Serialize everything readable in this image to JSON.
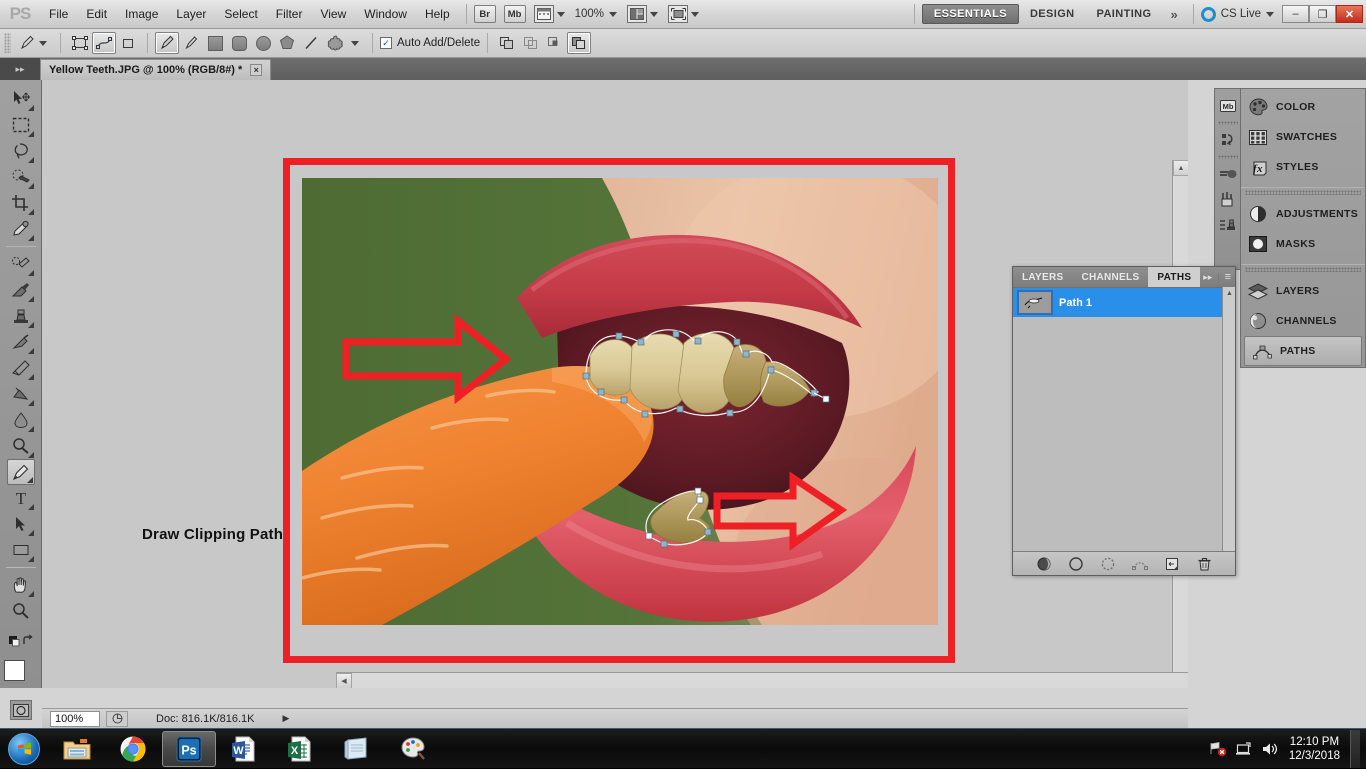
{
  "app": {
    "logo": "PS",
    "menus": [
      "File",
      "Edit",
      "Image",
      "Layer",
      "Select",
      "Filter",
      "View",
      "Window",
      "Help"
    ],
    "bridge_label": "Br",
    "minibridge_label": "Mb",
    "zoom_level": "100%",
    "workspaces": [
      {
        "label": "ESSENTIALS",
        "active": true
      },
      {
        "label": "DESIGN",
        "active": false
      },
      {
        "label": "PAINTING",
        "active": false
      }
    ],
    "more_workspaces": "»",
    "cslive_label": "CS Live",
    "window_controls": {
      "minimize": "–",
      "restore": "❐",
      "close": "✕"
    }
  },
  "options_bar": {
    "auto_add_delete_label": "Auto Add/Delete",
    "auto_add_delete_checked": true,
    "check_glyph": "✓",
    "tools": [
      "pen-tool",
      "freeform-pen-tool"
    ],
    "shape_tools": [
      "rectangle",
      "rounded-rectangle",
      "ellipse",
      "polygon",
      "line",
      "custom-shape"
    ],
    "mode_buttons": [
      "shape-layers",
      "paths",
      "fill-pixels"
    ],
    "path_ops": [
      "add-to-path-area",
      "subtract-from-path-area",
      "intersect-path-areas",
      "exclude-overlapping-path-areas"
    ]
  },
  "document": {
    "tab_title": "Yellow Teeth.JPG @ 100% (RGB/8#) *",
    "close_glyph": "×"
  },
  "toolbar": {
    "tools": [
      {
        "name": "move-tool",
        "selected": false
      },
      {
        "name": "rectangular-marquee-tool",
        "selected": false
      },
      {
        "name": "lasso-tool",
        "selected": false
      },
      {
        "name": "quick-selection-tool",
        "selected": false
      },
      {
        "name": "crop-tool",
        "selected": false
      },
      {
        "name": "eyedropper-tool",
        "selected": false
      },
      {
        "name": "spot-healing-brush-tool",
        "selected": false
      },
      {
        "name": "brush-tool",
        "selected": false
      },
      {
        "name": "clone-stamp-tool",
        "selected": false
      },
      {
        "name": "history-brush-tool",
        "selected": false
      },
      {
        "name": "eraser-tool",
        "selected": false
      },
      {
        "name": "gradient-tool",
        "selected": false
      },
      {
        "name": "blur-tool",
        "selected": false
      },
      {
        "name": "dodge-tool",
        "selected": false
      },
      {
        "name": "pen-tool",
        "selected": true
      },
      {
        "name": "horizontal-type-tool",
        "selected": false
      },
      {
        "name": "path-selection-tool",
        "selected": false
      },
      {
        "name": "rectangle-tool",
        "selected": false
      },
      {
        "name": "hand-tool",
        "selected": false
      },
      {
        "name": "zoom-tool",
        "selected": false
      }
    ],
    "foreground_color": "#ffffff",
    "background_color": "#ffffff",
    "quick_mask_name": "edit-in-quick-mask-mode"
  },
  "status_bar": {
    "zoom_value": "100%",
    "doc_info": "Doc: 816.1K/816.1K",
    "arrow_glyph": "▶"
  },
  "annotation": {
    "label": "Draw Clipping Path",
    "frame_color": "#ee2026",
    "arrows": [
      {
        "name": "arrow-pointing-to-upper-teeth",
        "direction": "right"
      },
      {
        "name": "arrow-pointing-to-lower-teeth",
        "direction": "left"
      }
    ]
  },
  "paths_panel": {
    "tabs": [
      {
        "label": "LAYERS",
        "active": false
      },
      {
        "label": "CHANNELS",
        "active": false
      },
      {
        "label": "PATHS",
        "active": true
      }
    ],
    "collapse_glyph": "▸▸",
    "menu_glyph": "≡",
    "paths": [
      {
        "name": "Path 1",
        "selected": true
      }
    ],
    "footer_buttons": [
      "fill-path-with-foreground-color",
      "stroke-path-with-brush",
      "load-path-as-selection",
      "make-work-path-from-selection",
      "create-new-path",
      "delete-current-path"
    ]
  },
  "dock": {
    "collapsed_icons": [
      "mini-bridge-icon",
      "history-icon",
      "brush-icon",
      "tool-presets-icon",
      "clone-source-icon"
    ],
    "groups": [
      {
        "items": [
          {
            "label": "COLOR",
            "icon": "color-palette-icon",
            "active": false
          },
          {
            "label": "SWATCHES",
            "icon": "swatches-grid-icon",
            "active": false
          },
          {
            "label": "STYLES",
            "icon": "styles-fx-icon",
            "active": false
          }
        ]
      },
      {
        "items": [
          {
            "label": "ADJUSTMENTS",
            "icon": "adjustments-halfcircle-icon",
            "active": false
          },
          {
            "label": "MASKS",
            "icon": "masks-icon",
            "active": false
          }
        ]
      },
      {
        "items": [
          {
            "label": "LAYERS",
            "icon": "layers-stack-icon",
            "active": false
          },
          {
            "label": "CHANNELS",
            "icon": "channels-sphere-icon",
            "active": false
          },
          {
            "label": "PATHS",
            "icon": "paths-pen-icon",
            "active": true
          }
        ]
      }
    ]
  },
  "taskbar": {
    "start_name": "start-orb",
    "items": [
      {
        "name": "windows-explorer",
        "active": false
      },
      {
        "name": "google-chrome",
        "active": false
      },
      {
        "name": "adobe-photoshop",
        "active": true
      },
      {
        "name": "microsoft-word",
        "active": false
      },
      {
        "name": "microsoft-excel",
        "active": false
      },
      {
        "name": "notepad",
        "active": false
      },
      {
        "name": "paint",
        "active": false
      }
    ],
    "tray_icons": [
      "network-error-icon",
      "action-center-icon",
      "volume-icon"
    ],
    "time": "12:10 PM",
    "date": "12/3/2018"
  }
}
